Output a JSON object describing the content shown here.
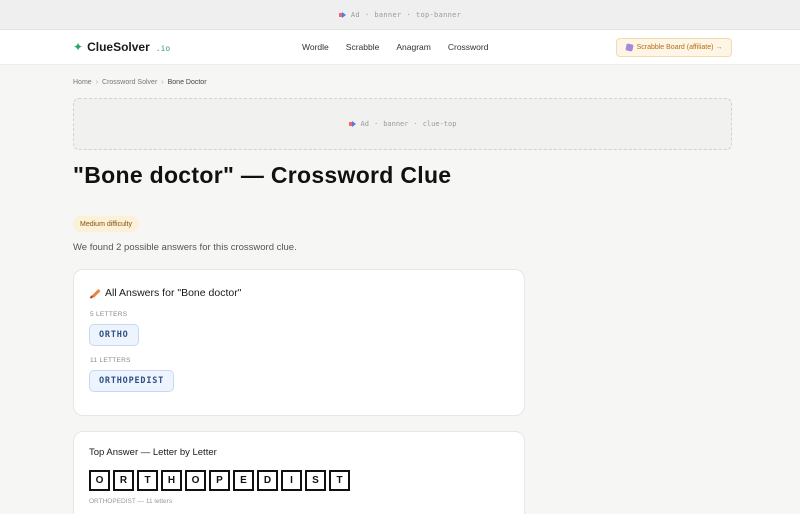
{
  "ads": {
    "top_banner": {
      "ad": "Ad",
      "sep1": "·",
      "kind": "banner",
      "sep2": "·",
      "slot": "top-banner"
    },
    "clue_top": {
      "ad": "Ad",
      "sep1": "·",
      "kind": "banner",
      "sep2": "·",
      "slot": "clue-top"
    }
  },
  "header": {
    "logo_name": "ClueSolver",
    "logo_tld": ".io",
    "nav": [
      "Wordle",
      "Scrabble",
      "Anagram",
      "Crossword"
    ],
    "affiliate_label": "Scrabble Board (affiliate) →"
  },
  "breadcrumb": {
    "items": [
      "Home",
      "Crossword Solver",
      "Bone Doctor"
    ],
    "separator": "›"
  },
  "page": {
    "title": "\"Bone doctor\" — Crossword Clue",
    "difficulty": "Medium difficulty",
    "summary": "We found 2 possible answers for this crossword clue."
  },
  "answers": {
    "title": "All Answers for \"Bone doctor\"",
    "groups": [
      {
        "length_label": "5 LETTERS",
        "answer": "ORTHO"
      },
      {
        "length_label": "11 LETTERS",
        "answer": "ORTHOPEDIST"
      }
    ]
  },
  "top_answer": {
    "title": "Top Answer — Letter by Letter",
    "letters": [
      "O",
      "R",
      "T",
      "H",
      "O",
      "P",
      "E",
      "D",
      "I",
      "S",
      "T"
    ],
    "caption": "ORTHOPEDIST — 11 letters"
  },
  "colors": {
    "accent_green": "#2fa36b",
    "chip_blue": "#2c4f86",
    "affiliate_orange": "#b86d12"
  }
}
